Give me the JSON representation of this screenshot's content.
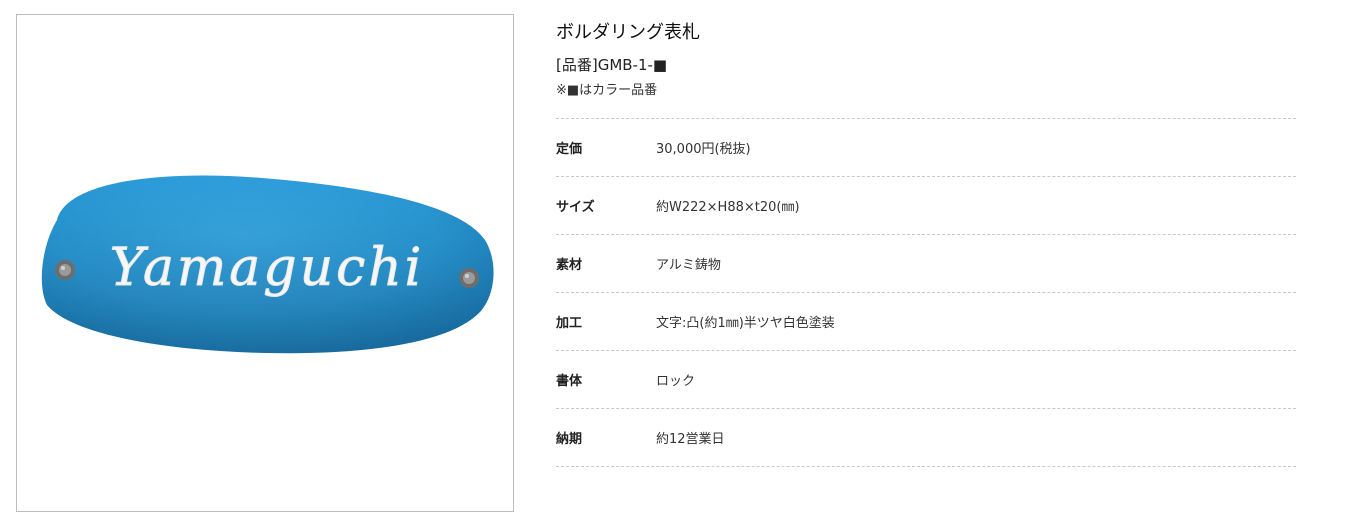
{
  "product": {
    "title": "ボルダリング表札",
    "code": "[品番]GMB-1-■",
    "note": "※■はカラー品番",
    "image_text": "Yamaguchi",
    "image_color": "#2a9ad8"
  },
  "specs": [
    {
      "label": "定価",
      "value": "30,000円(税抜)"
    },
    {
      "label": "サイズ",
      "value": "約W222×H88×t20(㎜)"
    },
    {
      "label": "素材",
      "value": "アルミ鋳物"
    },
    {
      "label": "加工",
      "value": "文字:凸(約1㎜)半ツヤ白色塗装"
    },
    {
      "label": "書体",
      "value": "ロック"
    },
    {
      "label": "納期",
      "value": "約12営業日"
    }
  ]
}
